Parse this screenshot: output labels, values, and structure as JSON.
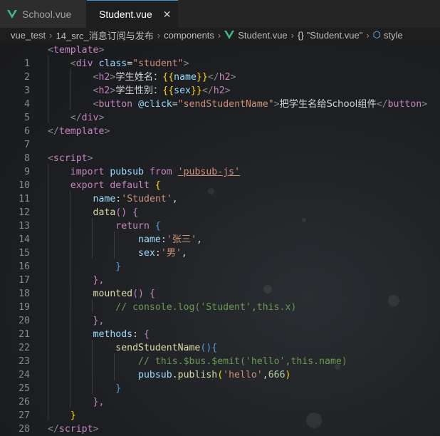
{
  "tabs": [
    {
      "label": "School.vue",
      "icon": "vue-icon",
      "active": false
    },
    {
      "label": "Student.vue",
      "icon": "vue-icon",
      "active": true
    }
  ],
  "breadcrumb": {
    "items": [
      "vue_test",
      "14_src_消息订阅与发布",
      "components",
      "Student.vue",
      "\"Student.vue\"",
      "style"
    ],
    "braces": "{}"
  },
  "code": {
    "line_numbers": [
      "1",
      "2",
      "3",
      "4",
      "5",
      "6",
      "7",
      "8",
      "9",
      "10",
      "11",
      "12",
      "13",
      "14",
      "15",
      "16",
      "17",
      "18",
      "19",
      "20",
      "21",
      "22",
      "23",
      "24",
      "25",
      "26",
      "27",
      "28",
      "29"
    ],
    "l1": {
      "t": "template"
    },
    "l2": {
      "t": "div",
      "attr": "class",
      "val": "\"student\""
    },
    "l3": {
      "t": "h2",
      "text": "学生姓名：",
      "brl": "{{",
      "var": "name",
      "brr": "}}"
    },
    "l4": {
      "t": "h2",
      "text": "学生性别：",
      "brl": "{{",
      "var": "sex",
      "brr": "}}"
    },
    "l5": {
      "t": "button",
      "attr": "@click",
      "val": "\"sendStudentName\"",
      "text": "把学生名给School组件"
    },
    "l6": {
      "t": "div"
    },
    "l7": {
      "t": "template"
    },
    "l9": {
      "t": "script"
    },
    "l10": {
      "kw1": "import",
      "name": "pubsub",
      "kw2": "from",
      "str": "'pubsub-js'"
    },
    "l11": {
      "kw1": "export",
      "kw2": "default",
      "br": "{"
    },
    "l12": {
      "key": "name",
      "str": "'Student'",
      "p": ","
    },
    "l13": {
      "fn": "data",
      "paren": "()",
      "br": "{"
    },
    "l14": {
      "kw": "return",
      "br": "{"
    },
    "l15": {
      "key": "name",
      "str": "'张三'",
      "p": ","
    },
    "l16": {
      "key": "sex",
      "str": "'男'",
      "p": ","
    },
    "l17": {
      "br": "}"
    },
    "l18": {
      "br": "},"
    },
    "l19": {
      "fn": "mounted",
      "paren": "()",
      "br": "{"
    },
    "l20": {
      "cm": "// console.log('Student',this.x)"
    },
    "l21": {
      "br": "},"
    },
    "l22": {
      "key": "methods",
      "br": "{"
    },
    "l23": {
      "fn": "sendStudentName",
      "paren": "(){"
    },
    "l24": {
      "cm": "// this.$bus.$emit('hello',this.name)"
    },
    "l25": {
      "obj": "pubsub",
      "fn": "publish",
      "str": "'hello'",
      "num": "666"
    },
    "l26": {
      "br": "}"
    },
    "l27": {
      "br": "},"
    },
    "l28": {
      "br": "}"
    },
    "l29": {
      "t": "script"
    }
  },
  "colors": {
    "tag_name": "#c586c0",
    "keyword": "#c586c0",
    "attribute": "#9cdcfe",
    "string": "#ce9178",
    "bracket": "#ffd700",
    "function": "#dcdcaa",
    "comment": "#6a9955",
    "number": "#b5cea8",
    "vue_green": "#41b883",
    "tab_accent": "#3c9bd6"
  }
}
